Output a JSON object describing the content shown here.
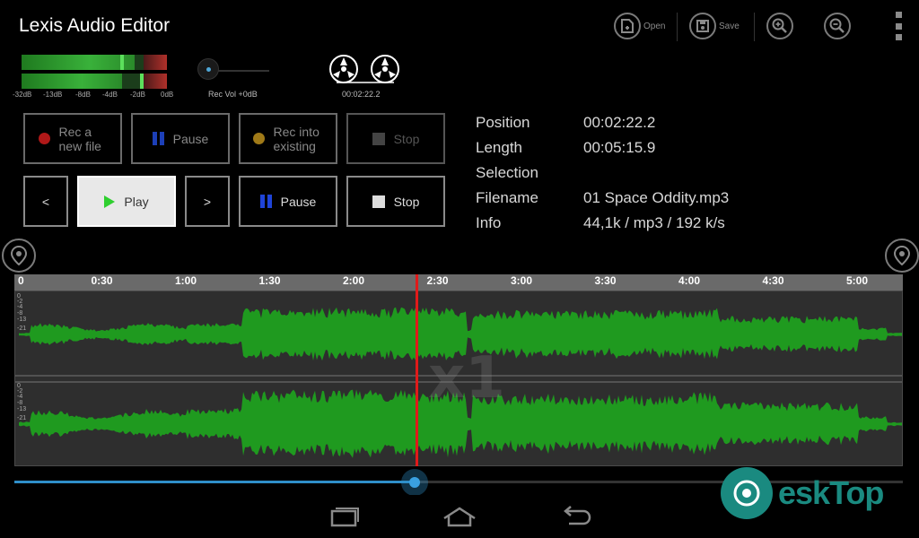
{
  "app": {
    "title": "Lexis Audio Editor"
  },
  "toolbar": {
    "open_label": "Open",
    "save_label": "Save",
    "zoom_in_icon": "zoom-in-icon",
    "zoom_out_icon": "zoom-out-icon",
    "menu_icon": "overflow-menu-icon"
  },
  "meters": {
    "left_level": 0.78,
    "right_level": 0.69,
    "scale": [
      "-32dB",
      "-13dB",
      "-8dB",
      "-4dB",
      "-2dB",
      "0dB"
    ]
  },
  "rec_vol": {
    "label": "Rec Vol +0dB"
  },
  "reels": {
    "time": "00:02:22.2"
  },
  "record_row": [
    {
      "label": "Rec a new file",
      "icon": "record-dot-icon",
      "color": "#b01818"
    },
    {
      "label": "Pause",
      "icon": "pause-icon",
      "color": "#1c3fb8"
    },
    {
      "label": "Rec into existing",
      "icon": "record-dot-icon",
      "color": "#a07a18"
    },
    {
      "label": "Stop",
      "icon": "stop-icon",
      "color": "#444444"
    }
  ],
  "play_row": {
    "prev_label": "<",
    "play_label": "Play",
    "next_label": ">",
    "pause_label": "Pause",
    "stop_label": "Stop"
  },
  "info": {
    "position_label": "Position",
    "position_value": "00:02:22.2",
    "length_label": "Length",
    "length_value": "00:05:15.9",
    "selection_label": "Selection",
    "selection_value": "",
    "filename_label": "Filename",
    "filename_value": "01 Space Oddity.mp3",
    "info_label": "Info",
    "info_value": "44,1k / mp3 / 192 k/s"
  },
  "timeline": {
    "ticks": [
      "0",
      "0:30",
      "1:00",
      "1:30",
      "2:00",
      "2:30",
      "3:00",
      "3:30",
      "4:00",
      "4:30",
      "5:00"
    ],
    "total_seconds": 315.9,
    "playhead_seconds": 142.2
  },
  "wave": {
    "zoom": "x1",
    "db_labels": [
      "0",
      "-2",
      "-4",
      "-8",
      "-13",
      "-21"
    ],
    "color": "#1f9a1f"
  },
  "seek": {
    "progress": 0.45
  },
  "watermark": {
    "text": "eskTop"
  }
}
